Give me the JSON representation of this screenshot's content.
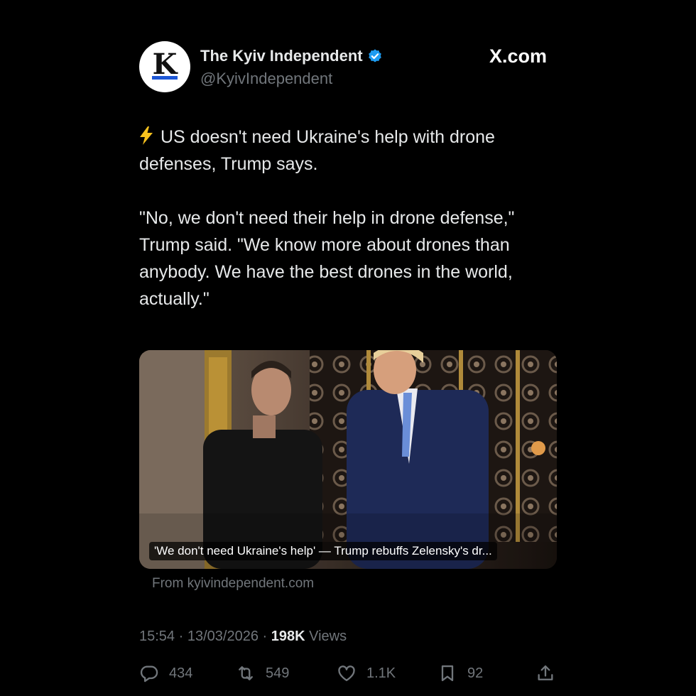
{
  "header": {
    "avatar_letter": "K",
    "display_name": "The Kyiv Independent",
    "handle": "@KyivIndependent",
    "site": "X.com"
  },
  "tweet": {
    "line1": "US doesn't need Ukraine's help with drone defenses, Trump says.",
    "line2": "\"No, we don't need their help in drone defense,\" Trump said. \"We know more about drones than anybody. We have the best drones in the world, actually.\""
  },
  "card": {
    "caption": "'We don't need Ukraine's help' — Trump rebuffs Zelensky's dr...",
    "source": "From kyivindependent.com"
  },
  "meta": {
    "time": "15:54",
    "date": "13/03/2026",
    "views_count": "198K",
    "views_label": "Views"
  },
  "actions": {
    "replies": "434",
    "reposts": "549",
    "likes": "1.1K",
    "bookmarks": "92"
  },
  "colors": {
    "background": "#000000",
    "text": "#e7e9ea",
    "muted": "#71767b",
    "verified": "#1d9bf0"
  }
}
